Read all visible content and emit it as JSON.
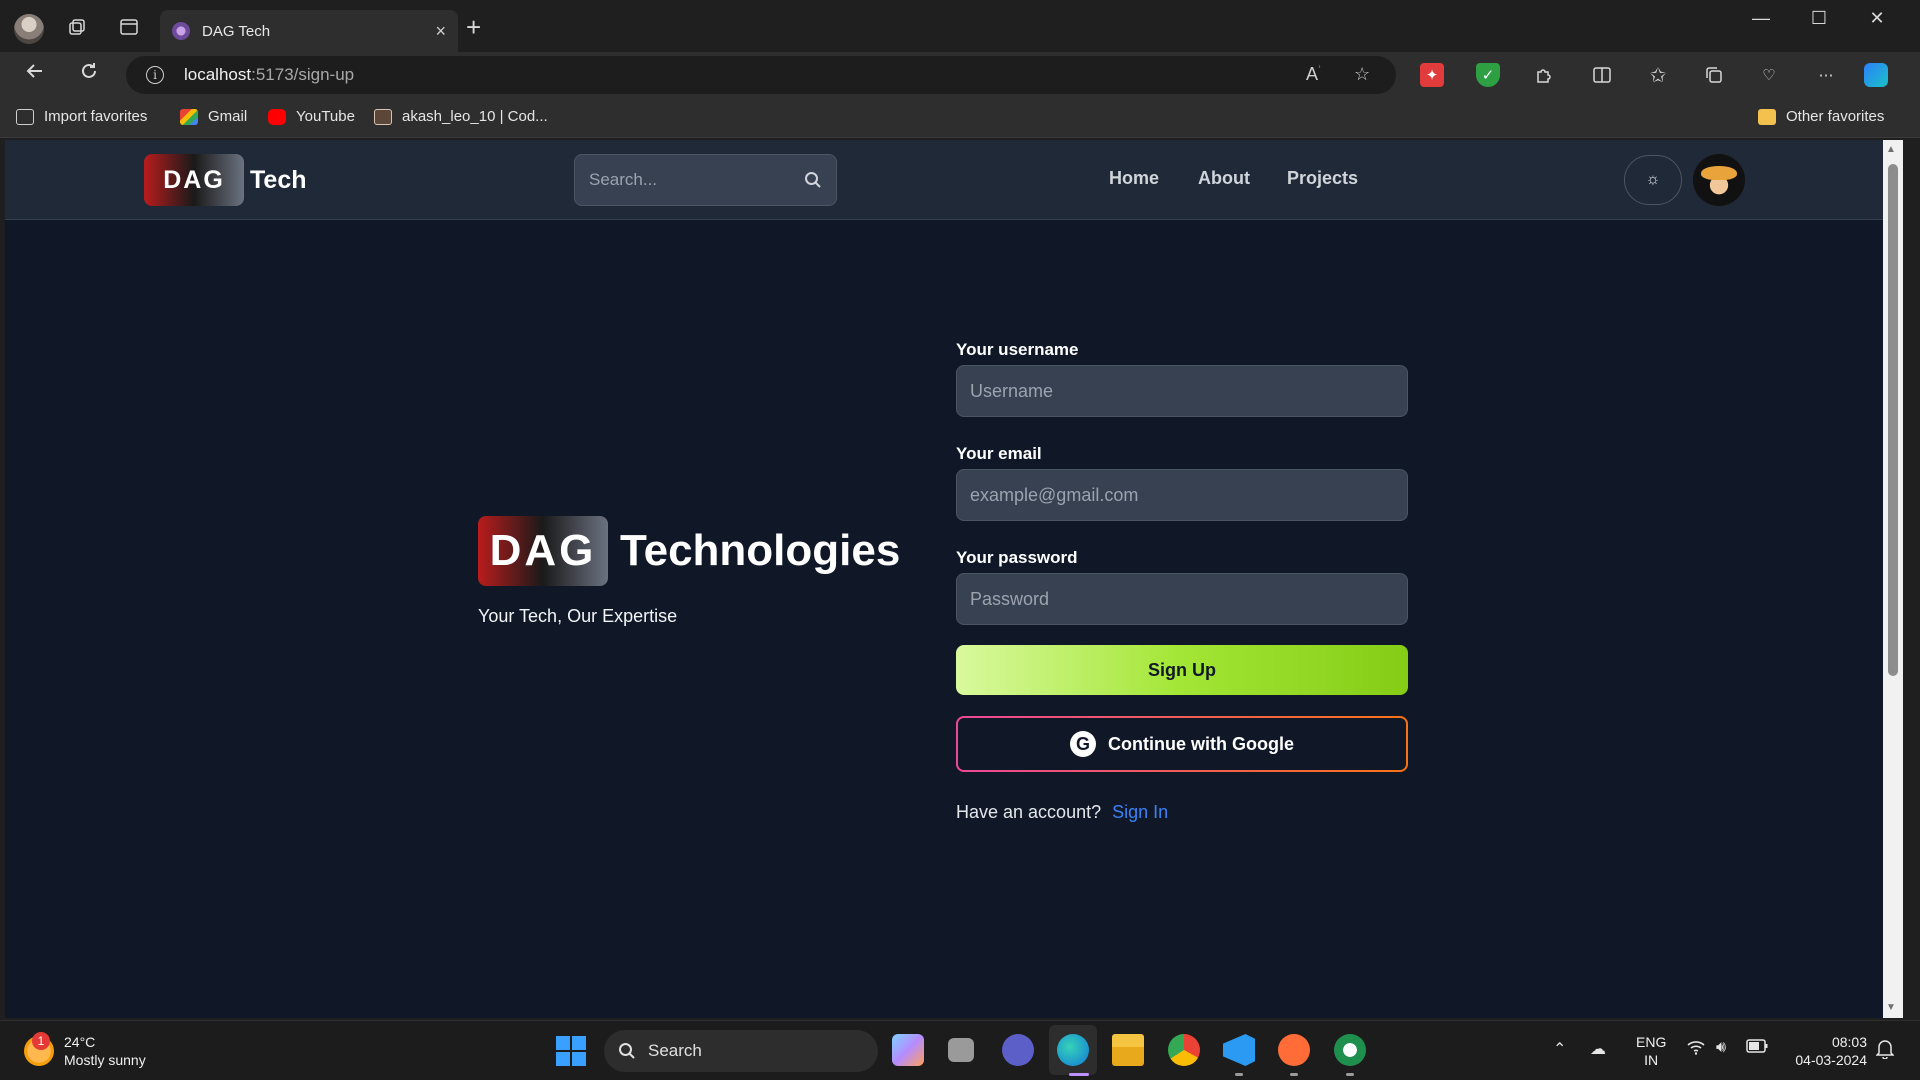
{
  "browser": {
    "tab_title": "DAG Tech",
    "tab_close": "×",
    "new_tab": "+",
    "url_host": "localhost",
    "url_path": ":5173/sign-up",
    "bookmarks": [
      {
        "label": "Import favorites",
        "icon": "import-icon"
      },
      {
        "label": "Gmail",
        "icon": "gmail-icon"
      },
      {
        "label": "YouTube",
        "icon": "youtube-icon"
      },
      {
        "label": "akash_leo_10 | Cod...",
        "icon": "codechef-icon"
      }
    ],
    "other_favorites": "Other favorites",
    "window_controls": {
      "minimize": "—",
      "maximize": "☐",
      "close": "✕"
    }
  },
  "header": {
    "logo_badge": "DAG",
    "logo_text": "Tech",
    "search_placeholder": "Search...",
    "nav": [
      "Home",
      "About",
      "Projects"
    ],
    "theme_icon": "☼"
  },
  "hero": {
    "badge": "DAG",
    "name": "Technologies",
    "tagline": "Your Tech, Our Expertise"
  },
  "form": {
    "username_label": "Your username",
    "username_placeholder": "Username",
    "email_label": "Your email",
    "email_placeholder": "example@gmail.com",
    "password_label": "Your password",
    "password_placeholder": "Password",
    "signup_button": "Sign Up",
    "google_button": "Continue with Google",
    "google_icon_letter": "G",
    "have_account": "Have an account?",
    "signin_link": "Sign In"
  },
  "taskbar": {
    "weather_temp": "24°C",
    "weather_desc": "Mostly sunny",
    "weather_badge": "1",
    "search_label": "Search",
    "lang_1": "ENG",
    "lang_2": "IN",
    "time": "08:03",
    "date": "04-03-2024"
  },
  "colors": {
    "page_bg": "#101828",
    "header_bg": "#1f2937",
    "input_bg": "#374151",
    "signup_gradient_start": "#d9f99d",
    "signup_gradient_end": "#84cc16",
    "google_border_start": "#ec4899",
    "google_border_end": "#f97316",
    "link": "#3b82f6"
  }
}
